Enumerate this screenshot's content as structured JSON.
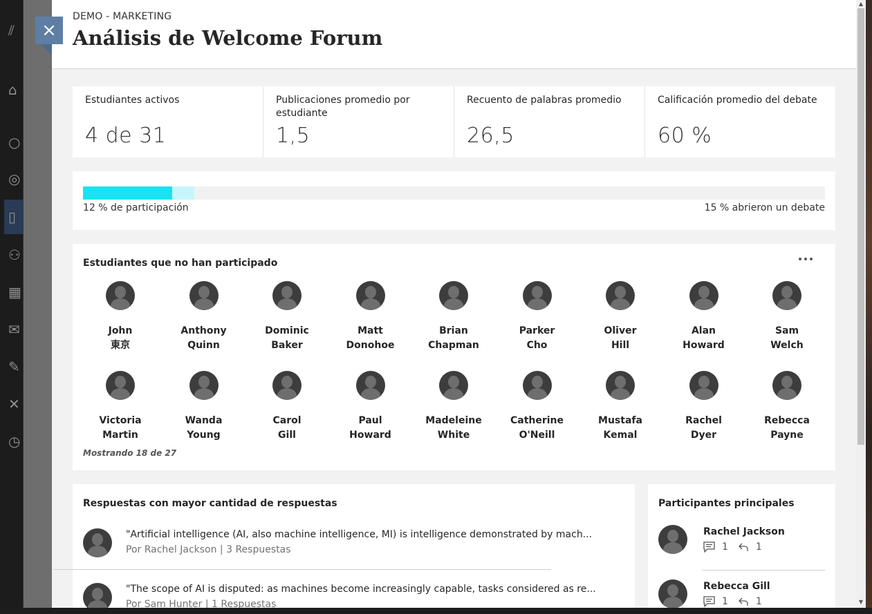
{
  "header": {
    "breadcrumb": "DEMO - MARKETING",
    "title": "Análisis de Welcome Forum",
    "close_label": "×"
  },
  "stats": [
    {
      "label": "Estudiantes activos",
      "value": "4 de 31"
    },
    {
      "label": "Publicaciones promedio por estudiante",
      "value": "1,5"
    },
    {
      "label": "Recuento de palabras promedio",
      "value": "26,5"
    },
    {
      "label": "Calificación promedio del debate",
      "value": "60 %"
    }
  ],
  "participation": {
    "participation_percent": 12,
    "opened_percent": 15,
    "participation_label": "12 % de participación",
    "opened_label": "15 % abrieron un debate",
    "colors": {
      "participation": "#18e3f3",
      "opened": "#c6f6fb",
      "track": "#f1f1f1"
    }
  },
  "non_participants": {
    "title": "Estudiantes que no han participado",
    "showing": "Mostrando 18 de 27",
    "students": [
      {
        "first": "John",
        "last": "東京"
      },
      {
        "first": "Anthony",
        "last": "Quinn"
      },
      {
        "first": "Dominic",
        "last": "Baker"
      },
      {
        "first": "Matt",
        "last": "Donohoe"
      },
      {
        "first": "Brian",
        "last": "Chapman"
      },
      {
        "first": "Parker",
        "last": "Cho"
      },
      {
        "first": "Oliver",
        "last": "Hill"
      },
      {
        "first": "Alan",
        "last": "Howard"
      },
      {
        "first": "Sam",
        "last": "Welch"
      },
      {
        "first": "Victoria",
        "last": "Martin"
      },
      {
        "first": "Wanda",
        "last": "Young"
      },
      {
        "first": "Carol",
        "last": "Gill"
      },
      {
        "first": "Paul",
        "last": "Howard"
      },
      {
        "first": "Madeleine",
        "last": "White"
      },
      {
        "first": "Catherine",
        "last": "O'Neill"
      },
      {
        "first": "Mustafa",
        "last": "Kemal"
      },
      {
        "first": "Rachel",
        "last": "Dyer"
      },
      {
        "first": "Rebecca",
        "last": "Payne"
      }
    ]
  },
  "top_replies": {
    "title": "Respuestas con mayor cantidad de respuestas",
    "items": [
      {
        "text": "\"Artificial intelligence (AI, also machine intelligence, MI) is intelligence demonstrated by mach...",
        "meta": "Por Rachel Jackson | 3 Respuestas"
      },
      {
        "text": "\"The scope of AI is disputed: as machines become increasingly capable, tasks considered as re...",
        "meta": "Por Sam Hunter | 1 Respuestas"
      }
    ]
  },
  "top_participants": {
    "title": "Participantes principales",
    "items": [
      {
        "name": "Rachel Jackson",
        "posts": "1",
        "replies": "1"
      },
      {
        "name": "Rebecca Gill",
        "posts": "1",
        "replies": "1"
      }
    ]
  },
  "icons": {
    "close": "close-icon",
    "more": "more-options-icon",
    "posts": "comment-icon",
    "replies": "reply-icon",
    "avatar": "user-avatar-icon"
  }
}
